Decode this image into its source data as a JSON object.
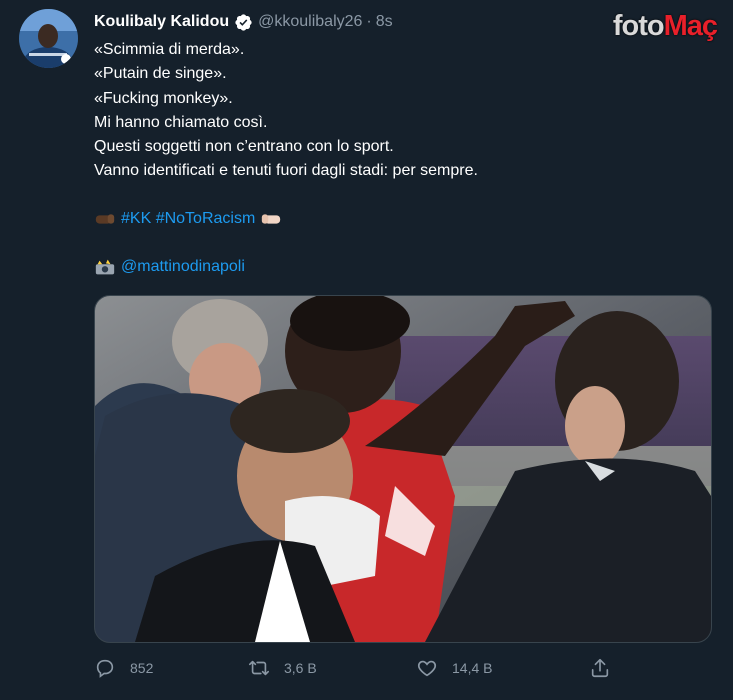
{
  "tweet": {
    "display_name": "Koulibaly Kalidou",
    "handle": "@kkoulibaly26",
    "separator": "·",
    "time": "8s",
    "lines": [
      "«Scimmia di merda».",
      "«Putain de singe».",
      "«Fucking monkey».",
      "Mi hanno chiamato così.",
      "Questi soggetti non c’entrano con lo sport.",
      "Vanno identificati e tenuti fuori dagli stadi: per sempre."
    ],
    "hashtags": "#KK #NoToRacism",
    "credit_mention": "@mattinodinapoli"
  },
  "watermark": {
    "part1": "foto",
    "part2": "Maç"
  },
  "actions": {
    "reply_count": "852",
    "retweet_count": "3,6 B",
    "like_count": "14,4 B"
  },
  "icons": {
    "verified": "verified-badge-icon",
    "reply": "reply-icon",
    "retweet": "retweet-icon",
    "like": "heart-icon",
    "share": "share-icon"
  },
  "colors": {
    "background": "#15202b",
    "link": "#1d9bf0",
    "muted": "#8b98a5"
  }
}
